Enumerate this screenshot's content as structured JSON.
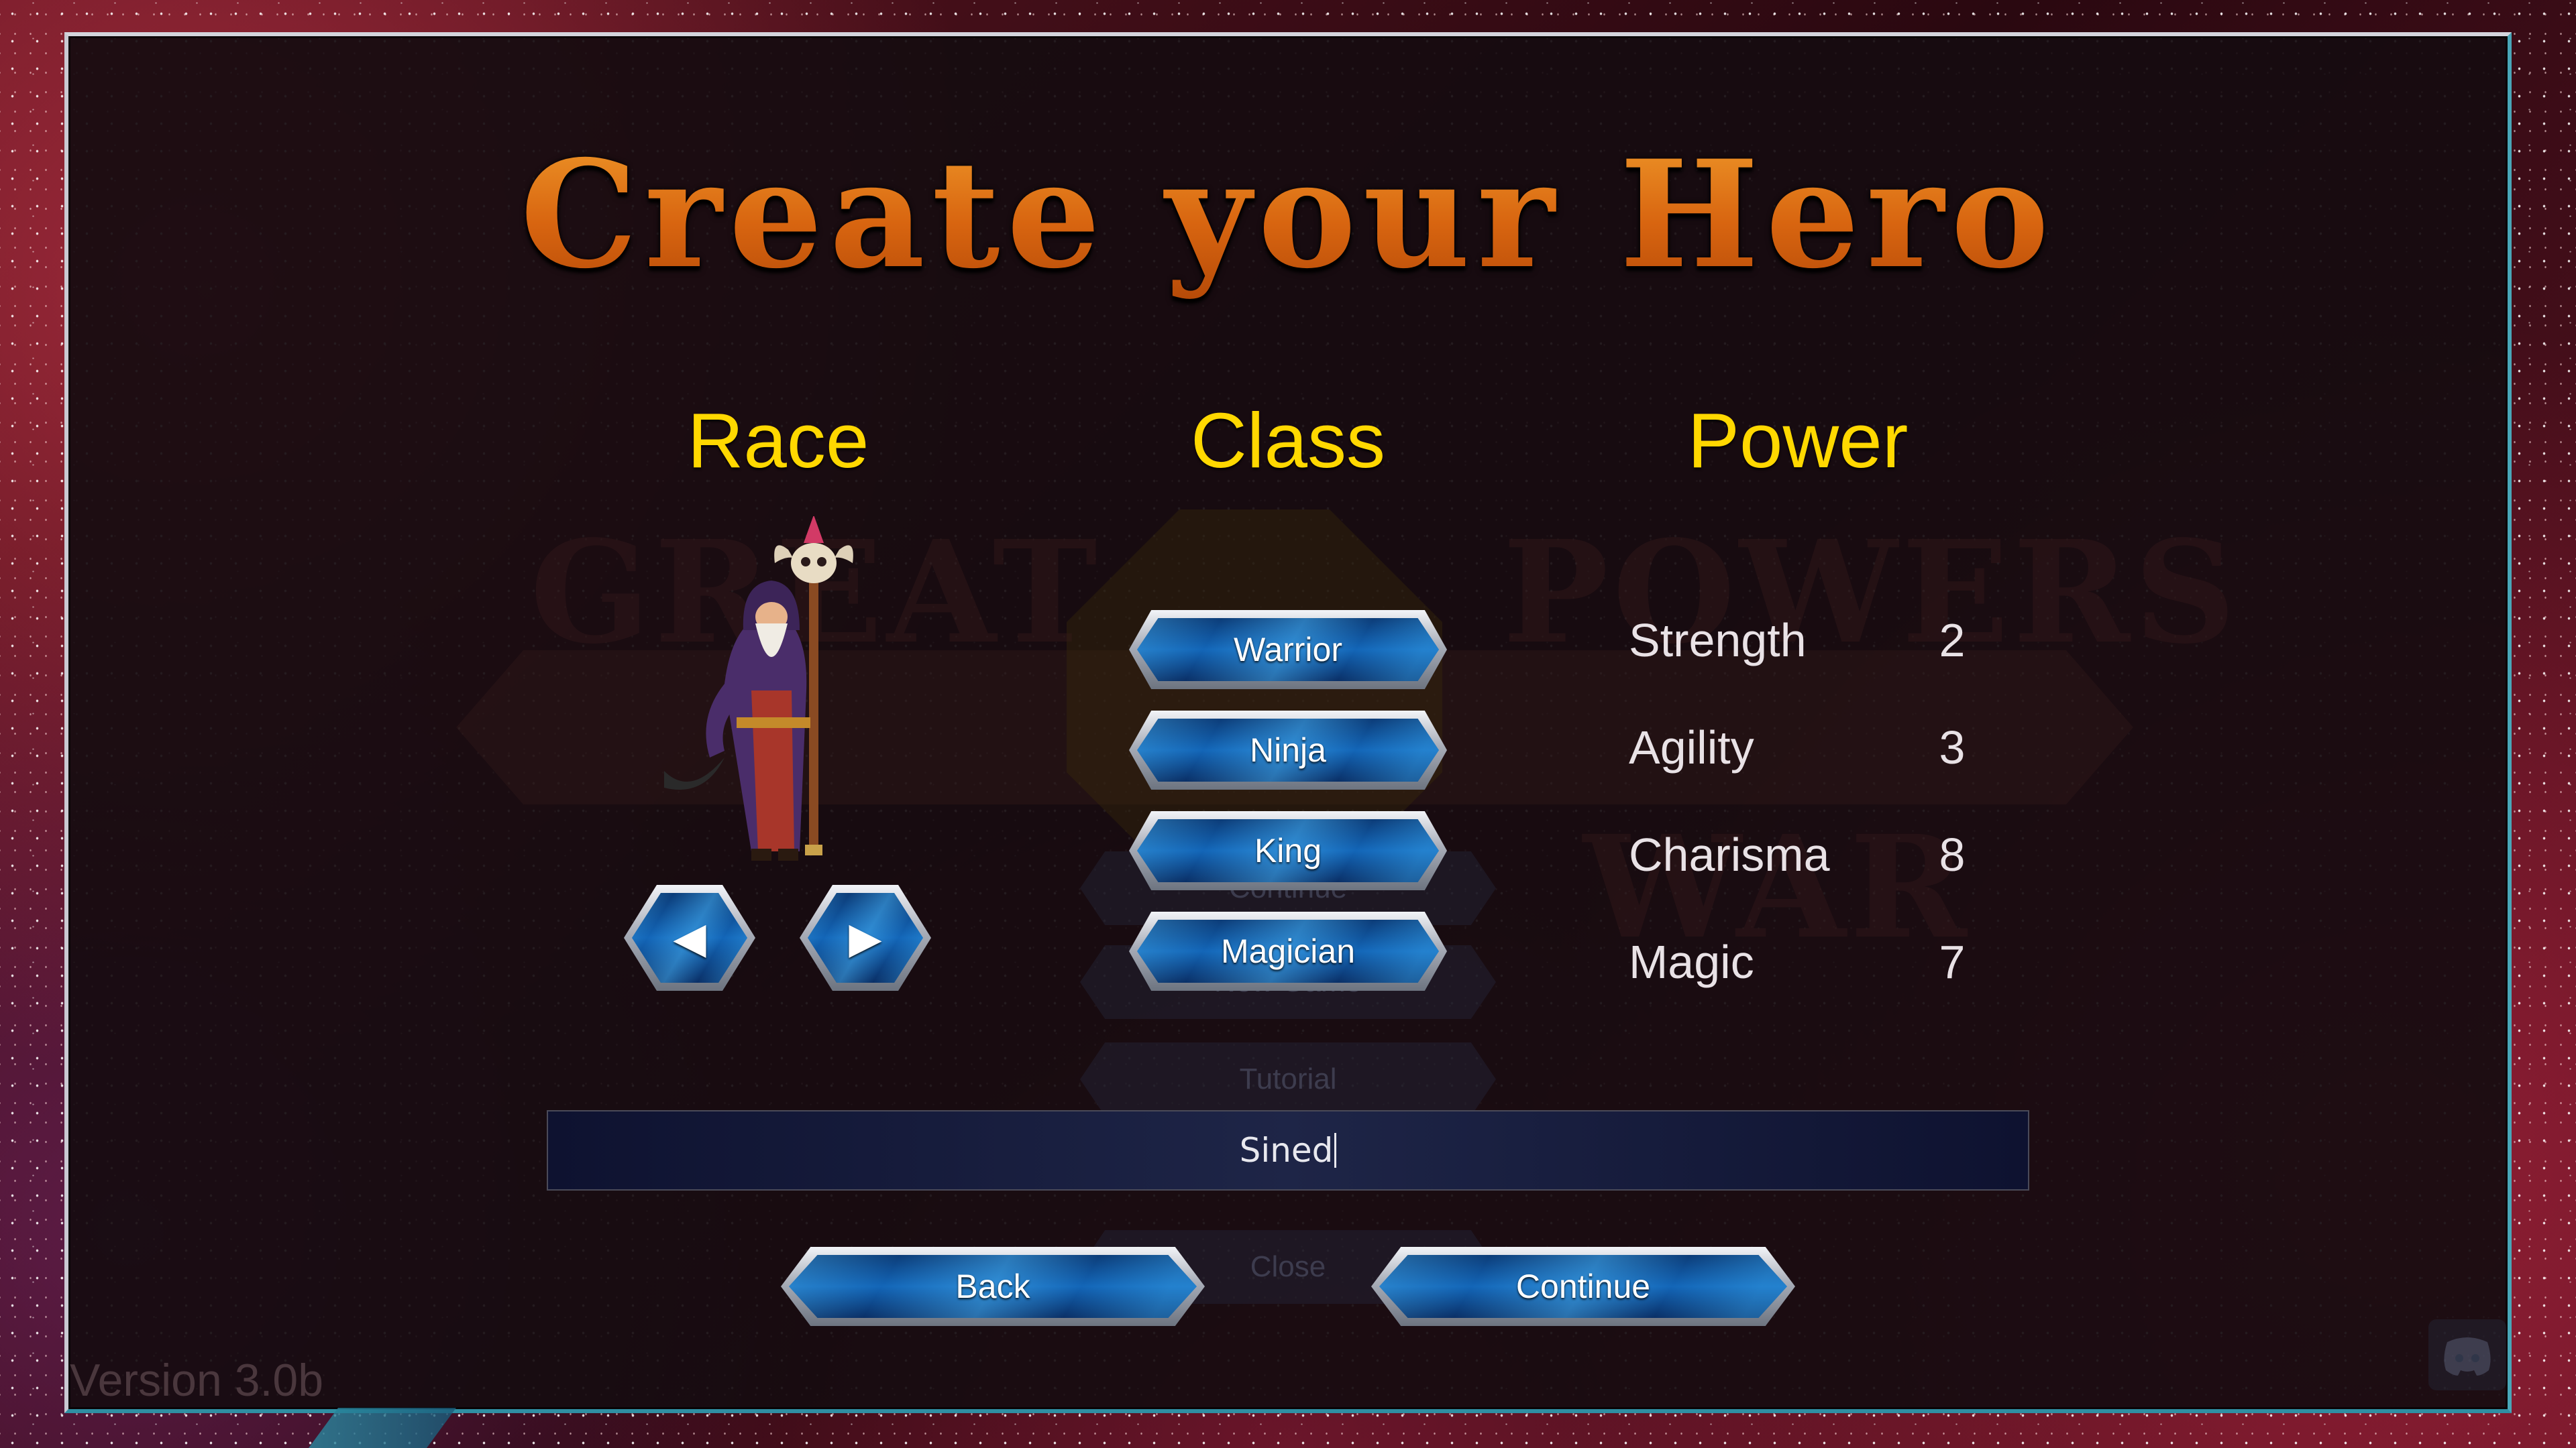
{
  "title": "Create your Hero",
  "columns": {
    "race": "Race",
    "class": "Class",
    "power": "Power"
  },
  "race_selector": {
    "prev_glyph": "◀",
    "next_glyph": "▶"
  },
  "classes": [
    "Warrior",
    "Ninja",
    "King",
    "Magician"
  ],
  "stats": [
    {
      "name": "Strength",
      "value": "2"
    },
    {
      "name": "Agility",
      "value": "3"
    },
    {
      "name": "Charisma",
      "value": "8"
    },
    {
      "name": "Magic",
      "value": "7"
    }
  ],
  "hero_name": {
    "value": "Sined"
  },
  "buttons": {
    "back": "Back",
    "continue": "Continue"
  },
  "background_menu": {
    "logo_words": [
      "GREAT",
      "POWERS",
      "WAR"
    ],
    "items": [
      "Continue",
      "New Game",
      "Tutorial",
      "Close"
    ]
  },
  "version": "Version 3.0b",
  "icons": {
    "hero": "wizard-hero-icon",
    "discord": "discord-icon"
  },
  "colors": {
    "title": "#e07a18",
    "column_heading": "#ffd800",
    "button_blue": "#1366b8",
    "stat_text": "#e9e2e6"
  }
}
